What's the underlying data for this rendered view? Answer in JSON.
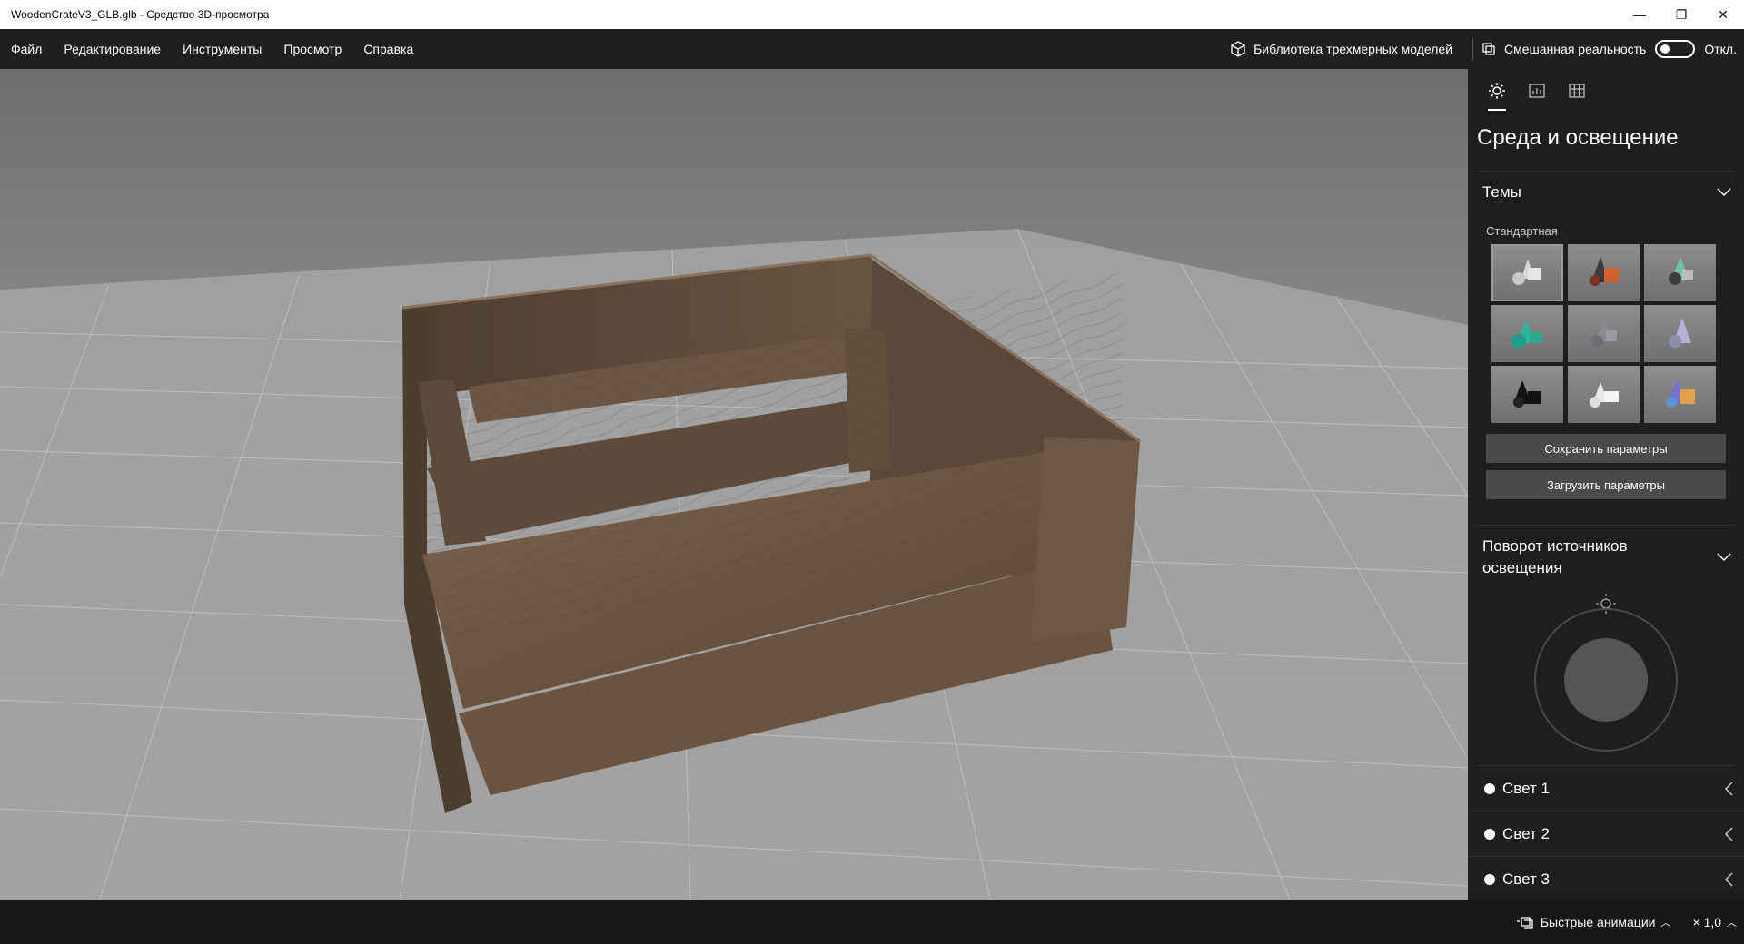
{
  "window": {
    "title": "WoodenCrateV3_GLB.glb - Средство 3D-просмотра",
    "minimize_glyph": "—",
    "restore_glyph": "❐",
    "close_glyph": "✕"
  },
  "menu": {
    "items": [
      "Файл",
      "Редактирование",
      "Инструменты",
      "Просмотр",
      "Справка"
    ],
    "library_label": "Библиотека трехмерных моделей",
    "mixed_reality_label": "Смешанная реальность",
    "mixed_reality_state": "Откл."
  },
  "panel": {
    "tabs": [
      "sun-icon",
      "stats-icon",
      "grid-icon"
    ],
    "title": "Среда и освещение",
    "themes_header": "Темы",
    "theme_subtitle": "Стандартная",
    "theme_count": 9,
    "save_button": "Сохранить параметры",
    "load_button": "Загрузить параметры",
    "rotation_header": "Поворот источников освещения",
    "lights": [
      "Свет 1",
      "Свет 2",
      "Свет 3"
    ]
  },
  "bottombar": {
    "animations_label": "Быстрые анимации",
    "speed_label": "× 1,0"
  },
  "colors": {
    "viewport_bg": "#8c8c8c",
    "panel_bg": "#1e1e1e",
    "button_bg": "#4a4a4a",
    "wood": "#6b5744"
  }
}
